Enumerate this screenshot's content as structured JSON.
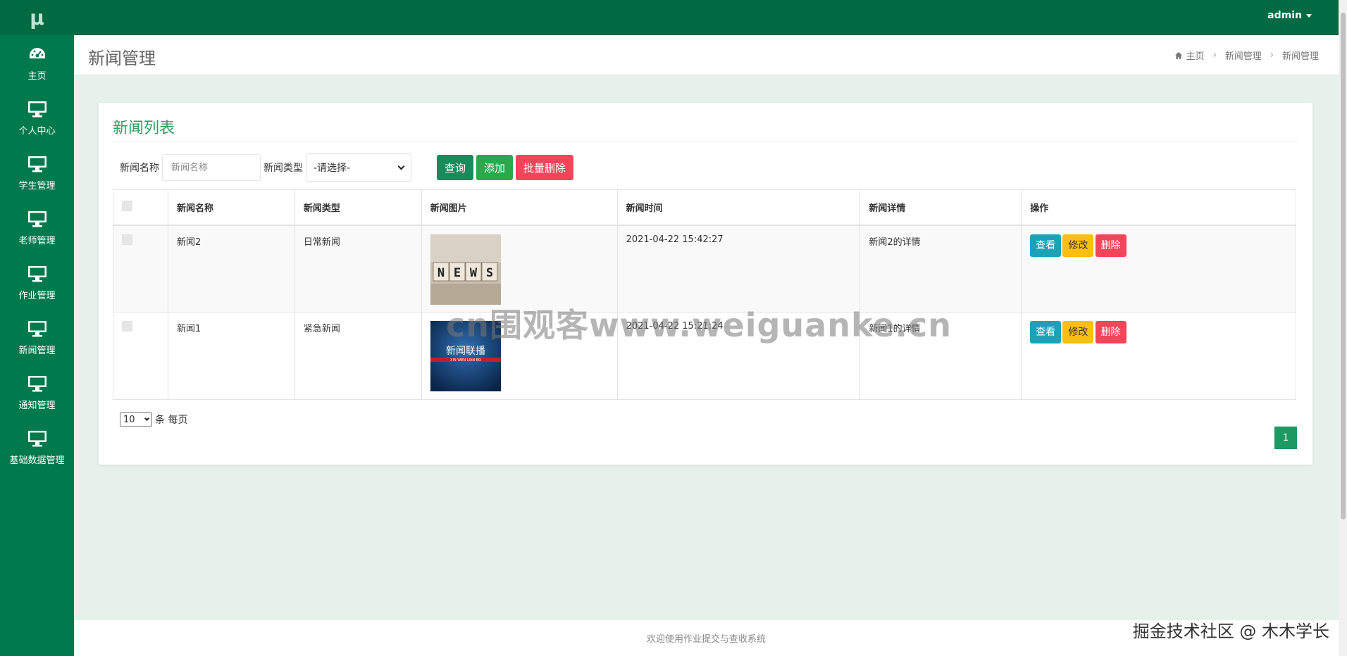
{
  "app": {
    "logo": "μ"
  },
  "sidebar": {
    "items": [
      {
        "label": "主页",
        "icon": "dashboard-icon"
      },
      {
        "label": "个人中心",
        "icon": "monitor-icon"
      },
      {
        "label": "学生管理",
        "icon": "monitor-icon"
      },
      {
        "label": "老师管理",
        "icon": "monitor-icon"
      },
      {
        "label": "作业管理",
        "icon": "monitor-icon"
      },
      {
        "label": "新闻管理",
        "icon": "monitor-icon"
      },
      {
        "label": "通知管理",
        "icon": "monitor-icon"
      },
      {
        "label": "基础数据管理",
        "icon": "monitor-icon"
      }
    ]
  },
  "topbar": {
    "user": "admin"
  },
  "header": {
    "title": "新闻管理",
    "breadcrumb": [
      "主页",
      "新闻管理",
      "新闻管理"
    ]
  },
  "card": {
    "title": "新闻列表",
    "search": {
      "name_label": "新闻名称",
      "name_placeholder": "新闻名称",
      "type_label": "新闻类型",
      "type_selected": "-请选择-",
      "query_button": "查询",
      "add_button": "添加",
      "batch_delete_button": "批量删除"
    },
    "table": {
      "columns": [
        "新闻名称",
        "新闻类型",
        "新闻图片",
        "新闻时间",
        "新闻详情",
        "操作"
      ],
      "rows": [
        {
          "name": "新闻2",
          "type": "日常新闻",
          "image": "news-cubes-image",
          "time": "2021-04-22 15:42:27",
          "detail": "新闻2的详情"
        },
        {
          "name": "新闻1",
          "type": "紧急新闻",
          "image": "xinwen-lianbo-image",
          "time": "2021-04-22 15:21:24",
          "detail": "新闻1的详情"
        }
      ],
      "actions": {
        "view": "查看",
        "edit": "修改",
        "delete": "删除"
      }
    },
    "pagination": {
      "page_size": "10",
      "per_page_label": "条 每页",
      "current_page": "1"
    }
  },
  "footer": {
    "text": "欢迎使用作业提交与查收系统"
  },
  "watermarks": {
    "center": "cn围观客www.weiguanke.cn",
    "bottom": "掘金技术社区 @ 木木学长"
  },
  "images": {
    "news_cubes_text": "NEWS",
    "lianbo_title": "新闻联播",
    "lianbo_sub": "XIN WEN LIAN BO"
  },
  "colors": {
    "sidebar": "#007a4d",
    "topbar": "#006a43",
    "accent": "#2f9e62"
  }
}
